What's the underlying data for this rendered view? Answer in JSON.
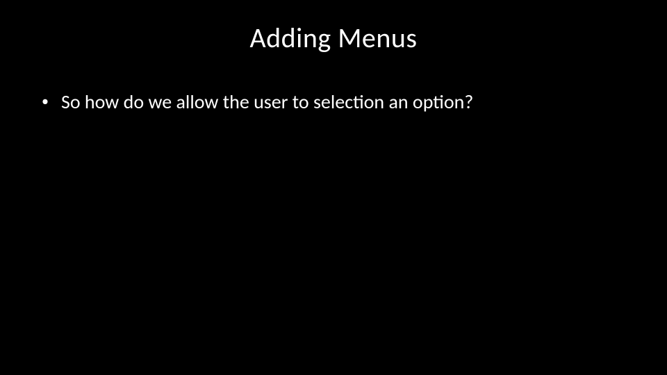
{
  "slide": {
    "title": "Adding Menus",
    "bullets": [
      {
        "text": "So how do we allow the user to selection an option?"
      }
    ]
  }
}
